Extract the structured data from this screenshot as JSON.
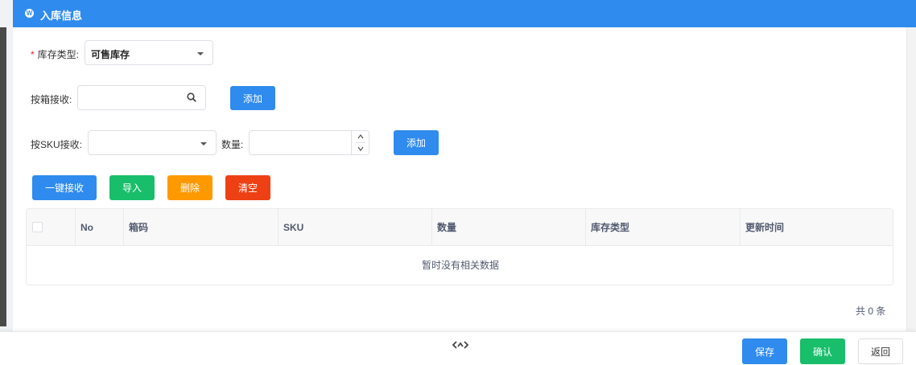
{
  "header": {
    "title": "入库信息",
    "logo_icon": "wordpress-icon"
  },
  "form": {
    "stock_type": {
      "required_mark": "*",
      "label": "库存类型:",
      "value": "可售库存"
    },
    "box_receive": {
      "label": "按箱接收:",
      "value": "",
      "placeholder": "",
      "add_label": "添加"
    },
    "sku_receive": {
      "label": "按SKU接收:",
      "value": "",
      "qty_label": "数量:",
      "qty_value": "",
      "add_label": "添加"
    }
  },
  "actions": {
    "one_click": "一键接收",
    "import": "导入",
    "delete": "删除",
    "clear": "清空"
  },
  "table": {
    "columns": [
      "No",
      "箱码",
      "SKU",
      "数量",
      "库存类型",
      "更新时间"
    ],
    "empty_text": "暂时没有相关数据",
    "total_text": "共 0 条"
  },
  "footer": {
    "save": "保存",
    "confirm": "确认",
    "back": "返回"
  },
  "colors": {
    "primary": "#2f8bed",
    "success": "#19be6b",
    "warning": "#ff9900",
    "danger": "#ed4014"
  }
}
